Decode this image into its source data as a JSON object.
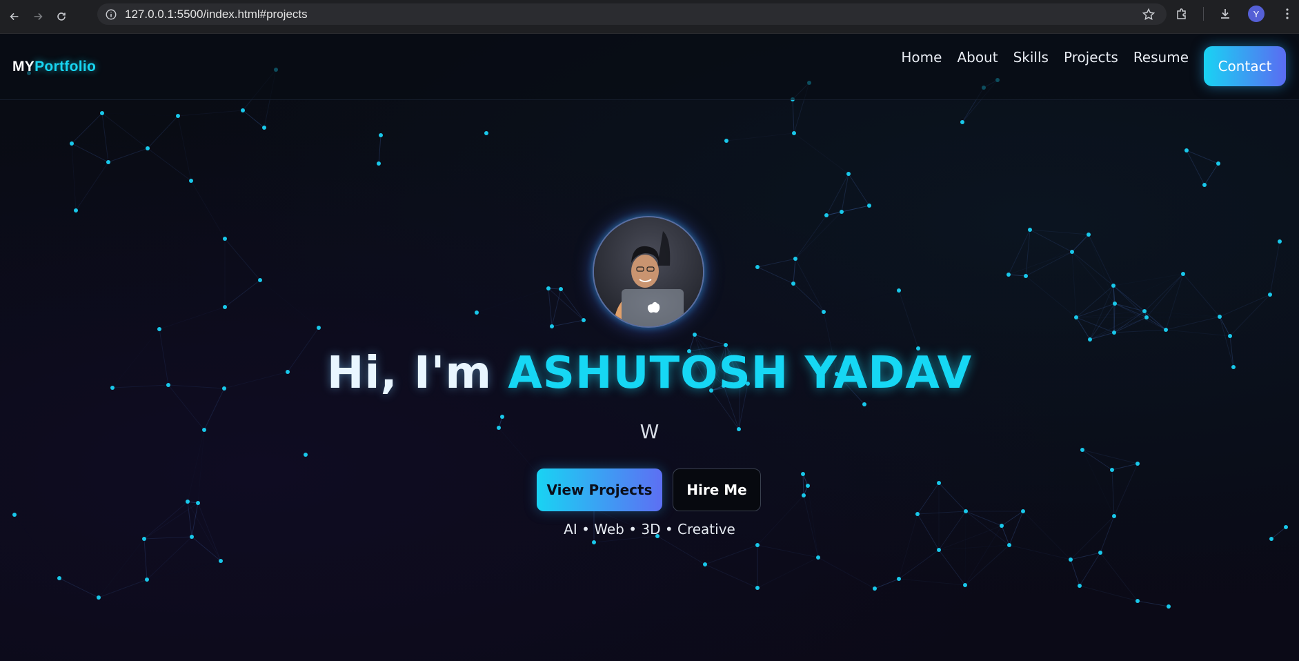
{
  "browser": {
    "url": "127.0.0.1:5500/index.html#projects",
    "profile_initial": "Y"
  },
  "nav": {
    "brand_prefix": "MY",
    "brand_suffix": "Portfolio",
    "links": [
      "Home",
      "About",
      "Skills",
      "Projects",
      "Resume"
    ],
    "contact_label": "Contact"
  },
  "hero": {
    "greeting": "Hi, I'm ",
    "name": "ASHUTOSH YADAV",
    "typed_text": "W",
    "primary_button": "View Projects",
    "secondary_button": "Hire Me",
    "tagline": "AI • Web • 3D • Creative"
  },
  "colors": {
    "accent": "#18d6f2",
    "accent_purple": "#5d6ff3",
    "background": "#07090f"
  }
}
